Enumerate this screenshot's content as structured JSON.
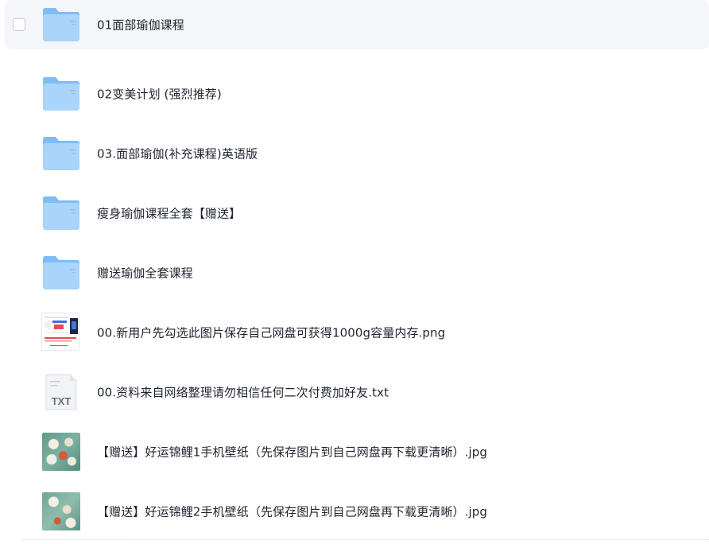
{
  "files": [
    {
      "name": "01面部瑜伽课程",
      "type": "folder"
    },
    {
      "name": "02变美计划 (强烈推荐)",
      "type": "folder"
    },
    {
      "name": "03.面部瑜伽(补充课程)英语版",
      "type": "folder"
    },
    {
      "name": "瘦身瑜伽课程全套【赠送】",
      "type": "folder"
    },
    {
      "name": "赠送瑜伽全套课程",
      "type": "folder"
    },
    {
      "name": "00.新用户先勾选此图片保存自己网盘可获得1000g容量内存.png",
      "type": "png"
    },
    {
      "name": "00.资料来自网络整理请勿相信任何二次付费加好友.txt",
      "type": "txt",
      "icon_label": "TXT"
    },
    {
      "name": "【赠送】好运锦鲤1手机壁纸（先保存图片到自己网盘再下载更清晰）.jpg",
      "type": "jpg"
    },
    {
      "name": "【赠送】好运锦鲤2手机壁纸（先保存图片到自己网盘再下载更清晰）.jpg",
      "type": "jpg"
    }
  ],
  "colors": {
    "folder_light": "#a9d4fb",
    "folder_dark": "#7fbcf5",
    "text": "#1f2430",
    "hover_bg": "#f5f6f9"
  }
}
